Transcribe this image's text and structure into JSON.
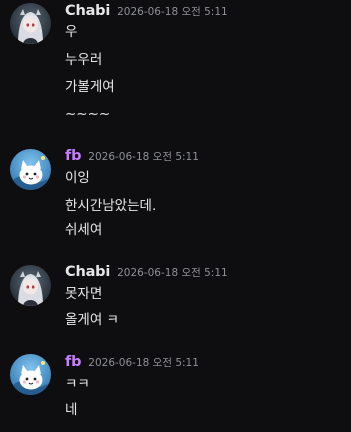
{
  "colors": {
    "background": "#0e0e10",
    "chabi_name": "#e6e6e8",
    "fb_name": "#c77dff",
    "timestamp": "#8e9096",
    "message_text": "#e8e8ea"
  },
  "messages": [
    {
      "author": "Chabi",
      "timestamp": "2026-06-18 오전 5:11",
      "avatar_icon": "silver-haired-girl-avatar-icon",
      "lines": [
        "우",
        "누우러",
        "가볼게여",
        "~~~~"
      ]
    },
    {
      "author": "fb",
      "timestamp": "2026-06-18 오전 5:11",
      "avatar_icon": "white-cat-mascot-avatar-icon",
      "lines": [
        "이잉",
        "한시간남았는데.",
        "쉬세여"
      ]
    },
    {
      "author": "Chabi",
      "timestamp": "2026-06-18 오전 5:11",
      "avatar_icon": "silver-haired-girl-avatar-icon",
      "lines": [
        "못자면",
        "올게여 ㅋ"
      ]
    },
    {
      "author": "fb",
      "timestamp": "2026-06-18 오전 5:11",
      "avatar_icon": "white-cat-mascot-avatar-icon",
      "lines": [
        "ㅋㅋ",
        "네"
      ]
    }
  ]
}
